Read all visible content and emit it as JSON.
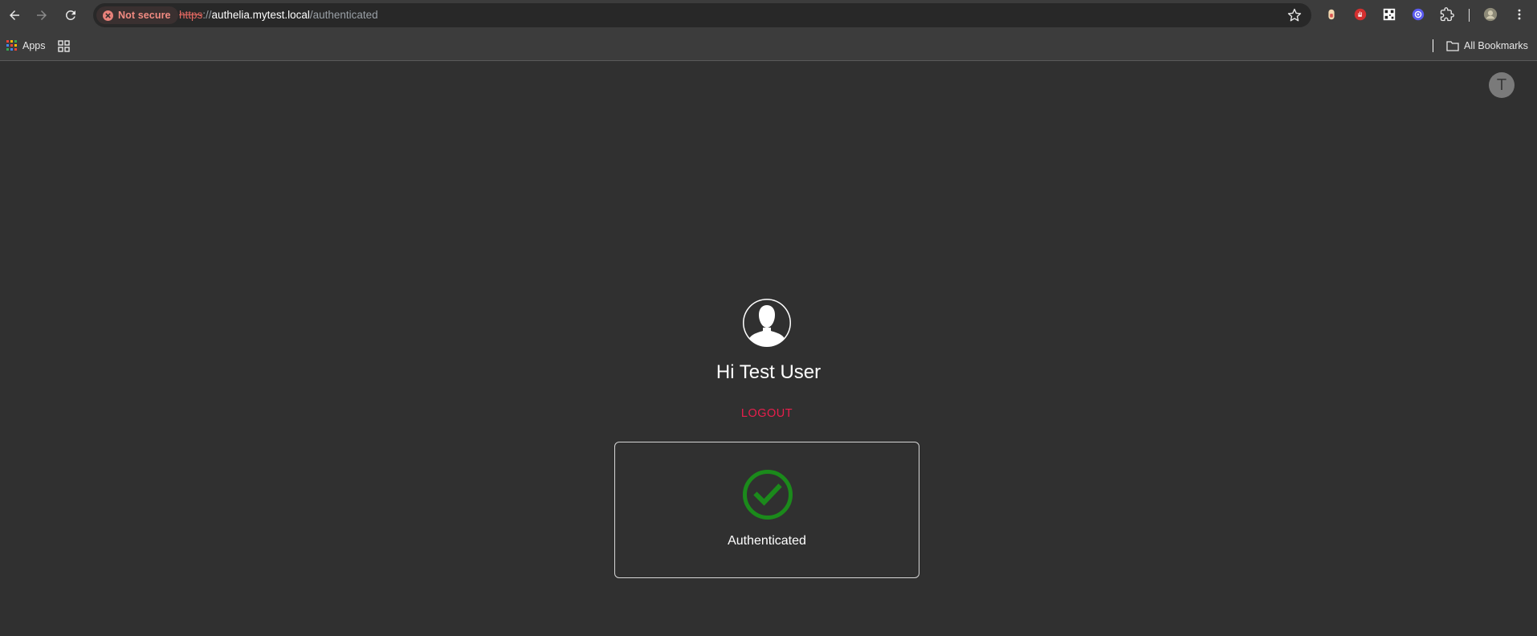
{
  "browser": {
    "security_label": "Not secure",
    "url": {
      "scheme": "https",
      "separator": "://",
      "host": "authelia.mytest.local",
      "path": "/authenticated"
    },
    "bookmarks": {
      "apps_label": "Apps",
      "all_bookmarks_label": "All Bookmarks"
    },
    "icons": [
      "back-icon",
      "forward-icon",
      "reload-icon",
      "star-icon",
      "extensions-icon",
      "profile-icon",
      "menu-icon"
    ]
  },
  "page": {
    "account_initial": "T",
    "greeting": "Hi Test User",
    "logout_label": "LOGOUT",
    "status_text": "Authenticated"
  },
  "colors": {
    "background": "#303030",
    "logout": "#e91e4c",
    "success": "#1b8a1b"
  }
}
